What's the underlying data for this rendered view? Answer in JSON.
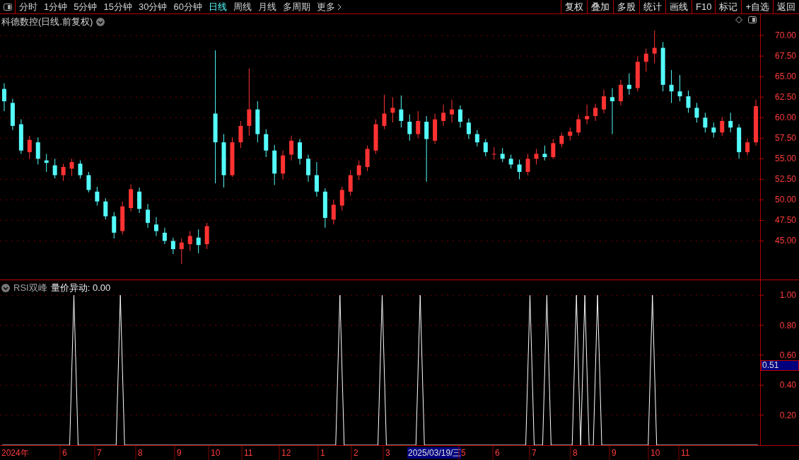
{
  "toolbar": {
    "periods": [
      {
        "label": "分时",
        "selected": false
      },
      {
        "label": "1分钟",
        "selected": false
      },
      {
        "label": "5分钟",
        "selected": false
      },
      {
        "label": "15分钟",
        "selected": false
      },
      {
        "label": "30分钟",
        "selected": false
      },
      {
        "label": "60分钟",
        "selected": false
      },
      {
        "label": "日线",
        "selected": true
      },
      {
        "label": "周线",
        "selected": false
      },
      {
        "label": "月线",
        "selected": false
      },
      {
        "label": "多周期",
        "selected": false
      }
    ],
    "more": "更多",
    "actions": [
      "复权",
      "叠加",
      "多股",
      "统计",
      "画线",
      "F10",
      "标记",
      "+自选",
      "返回"
    ]
  },
  "price_panel": {
    "title": "科德数控(日线.前复权)",
    "chart_data": {
      "type": "candlestick",
      "grid": true,
      "ylim": [
        40.3,
        72.6
      ],
      "yticks": [
        {
          "value": 70,
          "label": "70.00"
        },
        {
          "value": 67.5,
          "label": "67.50"
        },
        {
          "value": 65,
          "label": "65.00"
        },
        {
          "value": 62.5,
          "label": "62.50"
        },
        {
          "value": 60,
          "label": "60.00"
        },
        {
          "value": 57.5,
          "label": "57.50"
        },
        {
          "value": 55,
          "label": "55.00"
        },
        {
          "value": 52.5,
          "label": "52.50"
        },
        {
          "value": 50,
          "label": "50.00"
        },
        {
          "value": 47.5,
          "label": "47.50"
        },
        {
          "value": 45,
          "label": "45.00"
        }
      ],
      "ohlc": [
        [
          63.5,
          64.2,
          60.8,
          62
        ],
        [
          61.8,
          62.3,
          58.5,
          59
        ],
        [
          59.2,
          59.8,
          55.6,
          56
        ],
        [
          55.8,
          57.8,
          55,
          57.3
        ],
        [
          57,
          57.6,
          54.3,
          55
        ],
        [
          54.8,
          55.6,
          53.4,
          54.5
        ],
        [
          54.2,
          55,
          52.6,
          53
        ],
        [
          53,
          54.4,
          52.3,
          54
        ],
        [
          53.8,
          55,
          52.9,
          54.6
        ],
        [
          54.4,
          54.8,
          52.6,
          53
        ],
        [
          53,
          53.4,
          50.9,
          51.2
        ],
        [
          51,
          51.6,
          49.3,
          49.8
        ],
        [
          49.8,
          50.2,
          47.6,
          48
        ],
        [
          48,
          48.5,
          45.3,
          46
        ],
        [
          46.2,
          49.8,
          45.8,
          49.2
        ],
        [
          49,
          51.9,
          48.6,
          51.3
        ],
        [
          51,
          51.5,
          48.4,
          48.9
        ],
        [
          48.8,
          49.5,
          46.6,
          47.2
        ],
        [
          47,
          47.9,
          45.6,
          46.2
        ],
        [
          46,
          46.6,
          44.6,
          45
        ],
        [
          45,
          45.4,
          43.4,
          44
        ],
        [
          44,
          45.3,
          42.2,
          44.8
        ],
        [
          44.6,
          46.2,
          43.8,
          45.6
        ],
        [
          45.4,
          46.4,
          43.5,
          44.5
        ],
        [
          44.6,
          47.2,
          44,
          46.8
        ],
        [
          60.5,
          68.2,
          52,
          57
        ],
        [
          57,
          58,
          51.5,
          53
        ],
        [
          53,
          57.6,
          52.8,
          57
        ],
        [
          57,
          59.6,
          56.3,
          59
        ],
        [
          59,
          66,
          57.8,
          61
        ],
        [
          61,
          62,
          57,
          58
        ],
        [
          58,
          58.6,
          55.2,
          56
        ],
        [
          56,
          56.7,
          51.8,
          53.2
        ],
        [
          53.2,
          56,
          52.5,
          55.4
        ],
        [
          55.5,
          57.8,
          54.8,
          57.2
        ],
        [
          57,
          57.4,
          54.3,
          55
        ],
        [
          55,
          55.5,
          52.2,
          53
        ],
        [
          53,
          54.6,
          50.4,
          51
        ],
        [
          51,
          51.4,
          46.6,
          47.8
        ],
        [
          47.6,
          50,
          47,
          49.4
        ],
        [
          49.3,
          51.6,
          48.7,
          51.2
        ],
        [
          51,
          53.6,
          50.5,
          53
        ],
        [
          53,
          54.8,
          52.4,
          54.2
        ],
        [
          54,
          56.6,
          53.5,
          56.2
        ],
        [
          56,
          59.8,
          55.6,
          59.2
        ],
        [
          59,
          62.8,
          58.6,
          60.5
        ],
        [
          60.6,
          62.5,
          59.4,
          61.2
        ],
        [
          61,
          62.7,
          58.8,
          59.6
        ],
        [
          59.5,
          60.4,
          57.2,
          58
        ],
        [
          58,
          60.8,
          57.5,
          59.6
        ],
        [
          59.5,
          60.2,
          52.2,
          57.4
        ],
        [
          57.2,
          60.5,
          56.8,
          59.8
        ],
        [
          59.6,
          61.6,
          59,
          60.6
        ],
        [
          60.4,
          62.2,
          59.4,
          61
        ],
        [
          61,
          61.5,
          58.8,
          59.5
        ],
        [
          59.4,
          59.9,
          57.4,
          58
        ],
        [
          58,
          58.5,
          56.5,
          57
        ],
        [
          57,
          57.4,
          55.3,
          55.8
        ],
        [
          55.6,
          56.4,
          54.9,
          55.6
        ],
        [
          55.6,
          56.3,
          54.6,
          55
        ],
        [
          55,
          55.5,
          53.8,
          54.3
        ],
        [
          54.3,
          54.9,
          52.5,
          53.4
        ],
        [
          53.4,
          55.6,
          53,
          55
        ],
        [
          55,
          56.2,
          54.3,
          55.6
        ],
        [
          55.6,
          56.6,
          54.8,
          55.2
        ],
        [
          55.2,
          57.4,
          55,
          56.9
        ],
        [
          56.8,
          58.2,
          56.4,
          57.8
        ],
        [
          57.8,
          58.8,
          57.2,
          58.3
        ],
        [
          58.2,
          60.4,
          57.8,
          59.8
        ],
        [
          59.8,
          61.6,
          59.2,
          60.2
        ],
        [
          60.2,
          61.7,
          59.6,
          61.2
        ],
        [
          61,
          63.4,
          60.5,
          62.6
        ],
        [
          62.5,
          63.6,
          58,
          62
        ],
        [
          62,
          64.6,
          61.5,
          64
        ],
        [
          64,
          65.4,
          62.8,
          63.5
        ],
        [
          63.6,
          67.5,
          63.2,
          66.8
        ],
        [
          66.8,
          68.4,
          65.6,
          67.8
        ],
        [
          67.8,
          70.6,
          66.6,
          68.5
        ],
        [
          68.5,
          69.2,
          63.2,
          64
        ],
        [
          64,
          65.8,
          61.8,
          63.2
        ],
        [
          63.2,
          65.2,
          62,
          62.6
        ],
        [
          62.6,
          63.3,
          60.6,
          61.2
        ],
        [
          61.2,
          61.8,
          59.4,
          60
        ],
        [
          60,
          60.6,
          58.2,
          58.8
        ],
        [
          58.8,
          59.4,
          57.6,
          58.2
        ],
        [
          58.2,
          60.1,
          57.8,
          59.6
        ],
        [
          59.6,
          60.6,
          58.2,
          58.8
        ],
        [
          58.8,
          59.2,
          55,
          55.8
        ],
        [
          55.8,
          57.4,
          55.4,
          57
        ],
        [
          57,
          62.2,
          56.6,
          61.4
        ]
      ]
    }
  },
  "indicator_panel": {
    "name": "RSI双峰",
    "value_label": "量价异动: 0.00",
    "cursor_value": "0.51",
    "chart_data": {
      "type": "line",
      "grid": true,
      "ylim": [
        0,
        1.1
      ],
      "yticks": [
        {
          "value": 1,
          "label": "1.00"
        },
        {
          "value": 0.8,
          "label": "0.80"
        },
        {
          "value": 0.6,
          "label": "0.60"
        },
        {
          "value": 0.4,
          "label": "0.40"
        },
        {
          "value": 0.2,
          "label": "0.20"
        }
      ],
      "series": [
        {
          "color": "#ffffff",
          "values": [
            0,
            0,
            0,
            0,
            0,
            0,
            0,
            0,
            0,
            0,
            0,
            0,
            0,
            0,
            0,
            0,
            0,
            1,
            0,
            0,
            0,
            0,
            0,
            0,
            0,
            0,
            0,
            0,
            1,
            0,
            0,
            0,
            0,
            0,
            0,
            0,
            0,
            0,
            0,
            0,
            0,
            0,
            0,
            0,
            0,
            0,
            0,
            0,
            0,
            0,
            0,
            0,
            0,
            0,
            0,
            0,
            0,
            0,
            0,
            0,
            0,
            0,
            0,
            0,
            0,
            0,
            0,
            0,
            0,
            0,
            0,
            0,
            0,
            0,
            0,
            0,
            0,
            0,
            0,
            0,
            1,
            0,
            0,
            0,
            0,
            0,
            0,
            0,
            0,
            0,
            1,
            0,
            0,
            0,
            0,
            0,
            0,
            0,
            0,
            1,
            0,
            0,
            0,
            0,
            0,
            0,
            0,
            0,
            0,
            0,
            0,
            0,
            0,
            0,
            0,
            0,
            0,
            0,
            0,
            0,
            0,
            0,
            0,
            0,
            0,
            1,
            0,
            0,
            0,
            1,
            0,
            0,
            0,
            0,
            0,
            0,
            1,
            0,
            1,
            0,
            0,
            1,
            0,
            0,
            0,
            0,
            0,
            0,
            0,
            0,
            0,
            0,
            0,
            0,
            1,
            0,
            0,
            0,
            0,
            0,
            0,
            0,
            0,
            0,
            0,
            0,
            0,
            0,
            0,
            0,
            0,
            0,
            0,
            0,
            0,
            0,
            0,
            0,
            0,
            0
          ]
        }
      ]
    }
  },
  "date_axis": {
    "labels": [
      {
        "text": "2024年",
        "kind": "month"
      },
      {
        "text": "6",
        "kind": "month"
      },
      {
        "text": "7",
        "kind": "month"
      },
      {
        "text": "8",
        "kind": "month"
      },
      {
        "text": "9",
        "kind": "month"
      },
      {
        "text": "10",
        "kind": "month"
      },
      {
        "text": "11",
        "kind": "month"
      },
      {
        "text": "12",
        "kind": "month"
      },
      {
        "text": "1",
        "kind": "month"
      },
      {
        "text": "2",
        "kind": "month"
      },
      {
        "text": "3",
        "kind": "month"
      },
      {
        "text": "2025/03/19/三",
        "kind": "cursor"
      },
      {
        "text": "5",
        "kind": "month"
      },
      {
        "text": "6",
        "kind": "month"
      },
      {
        "text": "7",
        "kind": "month"
      },
      {
        "text": "8",
        "kind": "month"
      },
      {
        "text": "9",
        "kind": "month"
      },
      {
        "text": "10",
        "kind": "month"
      },
      {
        "text": "11",
        "kind": "month"
      }
    ]
  }
}
